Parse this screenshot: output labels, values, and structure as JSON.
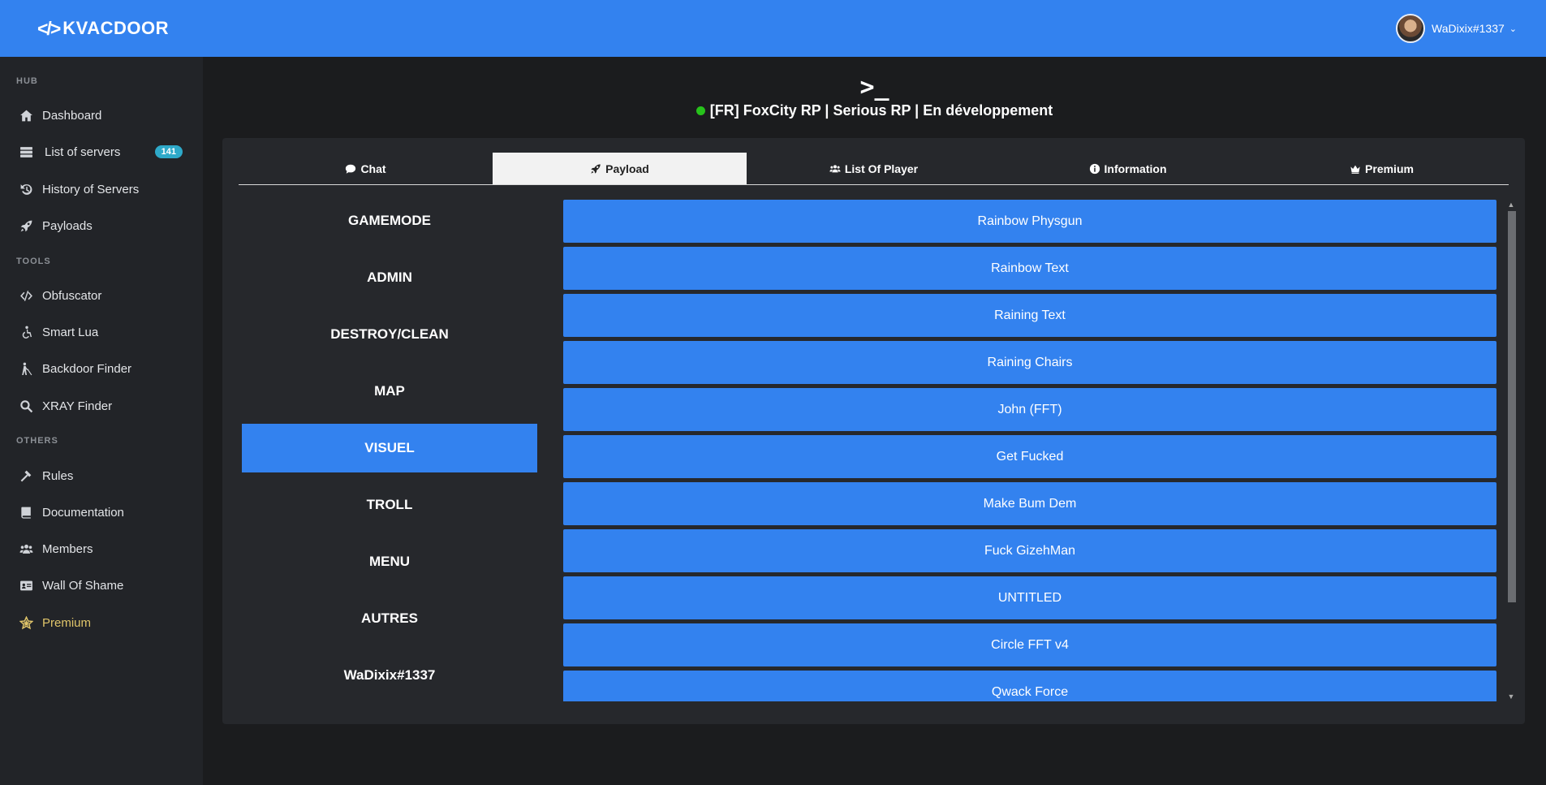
{
  "brand": {
    "glyph": "</>",
    "name": "KVACDOOR"
  },
  "user": {
    "name": "WaDixix#1337",
    "chevron": "⌄"
  },
  "sidebar": {
    "sections": {
      "hub": "HUB",
      "tools": "TOOLS",
      "others": "OTHERS"
    },
    "items": [
      {
        "label": "Dashboard",
        "icon": "home-icon"
      },
      {
        "label": "List of servers",
        "icon": "server-icon",
        "badge": "141"
      },
      {
        "label": "History of Servers",
        "icon": "history-icon"
      },
      {
        "label": "Payloads",
        "icon": "rocket-icon"
      },
      {
        "label": "Obfuscator",
        "icon": "code-icon"
      },
      {
        "label": "Smart Lua",
        "icon": "accessible-icon"
      },
      {
        "label": "Backdoor Finder",
        "icon": "blind-icon"
      },
      {
        "label": "XRAY Finder",
        "icon": "search-icon"
      },
      {
        "label": "Rules",
        "icon": "gavel-icon"
      },
      {
        "label": "Documentation",
        "icon": "book-icon"
      },
      {
        "label": "Members",
        "icon": "users-icon"
      },
      {
        "label": "Wall Of Shame",
        "icon": "id-card-icon"
      },
      {
        "label": "Premium",
        "icon": "star-icon"
      }
    ]
  },
  "header": {
    "terminal_glyph": ">_",
    "server_name": "[FR] FoxCity RP | Serious RP | En développement",
    "status_color": "#27c21b"
  },
  "tabs": [
    {
      "label": "Chat",
      "icon": "comment-icon"
    },
    {
      "label": "Payload",
      "icon": "rocket-icon",
      "active": true
    },
    {
      "label": "List Of Player",
      "icon": "users-icon"
    },
    {
      "label": "Information",
      "icon": "info-icon"
    },
    {
      "label": "Premium",
      "icon": "crown-icon"
    }
  ],
  "categories": [
    "GAMEMODE",
    "ADMIN",
    "DESTROY/CLEAN",
    "MAP",
    "VISUEL",
    "TROLL",
    "MENU",
    "AUTRES",
    "WaDixix#1337"
  ],
  "active_category": "VISUEL",
  "payloads": [
    "Rainbow Physgun",
    "Rainbow Text",
    "Raining Text",
    "Raining Chairs",
    "John (FFT)",
    "Get Fucked",
    "Make Bum Dem",
    "Fuck GizehMan",
    "UNTITLED",
    "Circle FFT v4",
    "Qwack Force"
  ],
  "colors": {
    "accent": "#3382ef",
    "sidebar_bg": "#222428",
    "page_bg": "#1b1c1e",
    "panel_bg": "#26282c",
    "premium": "#e0c56a",
    "badge": "#2ea9c9"
  }
}
